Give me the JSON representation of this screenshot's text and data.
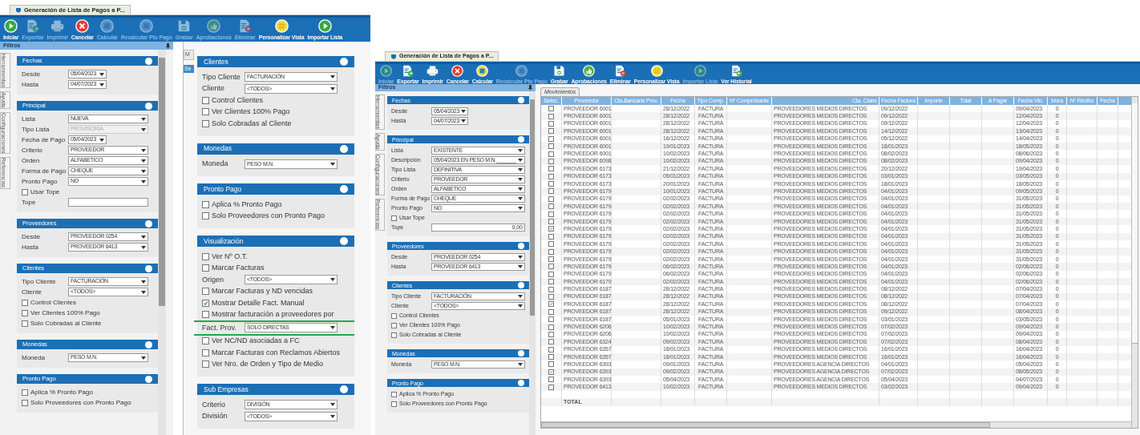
{
  "left_window": {
    "title": "Generación de Lista de Pagos a P...",
    "toolbar": [
      {
        "label": "Iniciar",
        "kind": "play",
        "disabled": false
      },
      {
        "label": "Exportar",
        "kind": "export",
        "disabled": true
      },
      {
        "label": "Imprimir",
        "kind": "print",
        "disabled": true
      },
      {
        "label": "Cancelar",
        "kind": "cancel",
        "disabled": false
      },
      {
        "label": "Calcular",
        "kind": "calc",
        "disabled": true
      },
      {
        "label": "Recalcular Pto Pago",
        "kind": "calc",
        "disabled": true
      },
      {
        "label": "Grabar",
        "kind": "save",
        "disabled": true
      },
      {
        "label": "Aprobaciones",
        "kind": "approve",
        "disabled": true
      },
      {
        "label": "Eliminar",
        "kind": "delete",
        "disabled": true
      },
      {
        "label": "Personalizar Vista",
        "kind": "grid",
        "disabled": false
      },
      {
        "label": "Importar Lista",
        "kind": "play",
        "disabled": false
      }
    ],
    "panel_title": "Filtros",
    "side_tabs": [
      "Herramientas",
      "Ayuda",
      "Configuraciones",
      "Referencias"
    ],
    "filter_sections": [
      {
        "title": "Fechas",
        "rows": [
          {
            "kind": "date",
            "label": "Desde",
            "value": "05/04/2023"
          },
          {
            "kind": "date",
            "label": "Hasta",
            "value": "04/07/2023"
          }
        ]
      },
      {
        "title": "Principal",
        "rows": [
          {
            "kind": "select",
            "label": "Lista",
            "value": "NUEVA"
          },
          {
            "kind": "select",
            "label": "Tipo Lista",
            "value": "PROVISORIA",
            "disabled": true
          },
          {
            "kind": "date",
            "label": "Fecha de Pago",
            "value": "05/04/2023"
          },
          {
            "kind": "select",
            "label": "Criterio",
            "value": "PROVEEDOR"
          },
          {
            "kind": "select",
            "label": "Orden",
            "value": "ALFABETICO"
          },
          {
            "kind": "select",
            "label": "Forma de Pago",
            "value": "CHEQUE"
          },
          {
            "kind": "select",
            "label": "Pronto Pago",
            "value": "NO"
          },
          {
            "kind": "checkbox",
            "label": "Usar Tope",
            "checked": false
          },
          {
            "kind": "input",
            "label": "Tope"
          }
        ]
      },
      {
        "title": "Proveedores",
        "rows": [
          {
            "kind": "select",
            "label": "Desde",
            "value": "PROVEEDOR 0254"
          },
          {
            "kind": "select",
            "label": "Hasta",
            "value": "PROVEEDOR 6413"
          }
        ]
      },
      {
        "title": "Clientes",
        "rows": [
          {
            "kind": "select",
            "label": "Tipo Cliente",
            "value": "FACTURACIÓN"
          },
          {
            "kind": "select",
            "label": "Cliente",
            "value": "<TODOS>"
          },
          {
            "kind": "checkbox",
            "label": "Control Clientes",
            "checked": false
          },
          {
            "kind": "checkbox",
            "label": "Ver Clientes 100% Pago",
            "checked": false
          },
          {
            "kind": "checkbox",
            "label": "Solo Cobradas al Cliente",
            "checked": false
          }
        ]
      },
      {
        "title": "Monedas",
        "rows": [
          {
            "kind": "select",
            "label": "Moneda",
            "value": "PESO M.N."
          }
        ]
      },
      {
        "title": "Pronto Pago",
        "rows": [
          {
            "kind": "checkbox",
            "label": "Aplica % Pronto Pago",
            "checked": false
          },
          {
            "kind": "checkbox",
            "label": "Solo Proveedores con Pronto Pago",
            "checked": false
          }
        ]
      }
    ],
    "background_tab": "M",
    "background_header": "Se",
    "option_sections": [
      {
        "title": "Clientes",
        "rows": [
          {
            "kind": "select",
            "label": "Tipo Cliente",
            "value": "FACTURACIÓN"
          },
          {
            "kind": "select",
            "label": "Cliente",
            "value": "<TODOS>"
          },
          {
            "kind": "checkbox",
            "label": "Control Clientes",
            "checked": false
          },
          {
            "kind": "checkbox",
            "label": "Ver Clientes 100% Pago",
            "checked": false
          },
          {
            "kind": "checkbox",
            "label": "Solo Cobradas al Cliente",
            "checked": false
          }
        ]
      },
      {
        "title": "Monedas",
        "rows": [
          {
            "kind": "select",
            "label": "Moneda",
            "value": "PESO M.N."
          }
        ]
      },
      {
        "title": "Pronto Pago",
        "rows": [
          {
            "kind": "checkbox",
            "label": "Aplica % Pronto Pago",
            "checked": false
          },
          {
            "kind": "checkbox",
            "label": "Solo Proveedores con Pronto Pago",
            "checked": false
          }
        ]
      },
      {
        "title": "Visualización",
        "rows": [
          {
            "kind": "checkbox",
            "label": "Ver Nº O.T.",
            "checked": false
          },
          {
            "kind": "checkbox",
            "label": "Marcar Facturas",
            "checked": false
          },
          {
            "kind": "select",
            "label": "Origen",
            "value": "<TODOS>"
          },
          {
            "kind": "checkbox",
            "label": "Marcar Facturas y ND vencidas",
            "checked": false
          },
          {
            "kind": "checkbox",
            "label": "Mostrar Detalle Fact. Manual",
            "checked": true
          },
          {
            "kind": "checkbox",
            "label": "Mostrar facturación a proveedores por",
            "checked": false
          },
          {
            "kind": "select",
            "label": "Fact. Prov.",
            "value": "SOLO DIRECTAS",
            "highlighted": true
          },
          {
            "kind": "checkbox",
            "label": "Ver NC/ND asociadas a FC",
            "checked": false
          },
          {
            "kind": "checkbox",
            "label": "Marcar Facturas con Reclamos Abiertos",
            "checked": false
          },
          {
            "kind": "checkbox",
            "label": "Ver Nro. de Orden y Tipo de Medio",
            "checked": false
          }
        ]
      },
      {
        "title": "Sub Empresas",
        "rows": [
          {
            "kind": "select",
            "label": "Criterio",
            "value": "DIVISIÓN"
          },
          {
            "kind": "select",
            "label": "División",
            "value": "<TODOS>"
          }
        ]
      }
    ]
  },
  "right_window": {
    "title": "Generación de Lista de Pagos a P...",
    "toolbar": [
      {
        "label": "Iniciar",
        "kind": "play",
        "disabled": true
      },
      {
        "label": "Exportar",
        "kind": "export",
        "disabled": false
      },
      {
        "label": "Imprimir",
        "kind": "print",
        "disabled": false
      },
      {
        "label": "Cancelar",
        "kind": "cancel",
        "disabled": false
      },
      {
        "label": "Calcular",
        "kind": "calc",
        "disabled": false
      },
      {
        "label": "Recalcular Pto Pago",
        "kind": "calc",
        "disabled": true
      },
      {
        "label": "Grabar",
        "kind": "save",
        "disabled": false
      },
      {
        "label": "Aprobaciones",
        "kind": "approve",
        "disabled": false
      },
      {
        "label": "Eliminar",
        "kind": "delete",
        "disabled": false
      },
      {
        "label": "Personalizar Vista",
        "kind": "grid",
        "disabled": false
      },
      {
        "label": "Importar Lista",
        "kind": "play",
        "disabled": true
      },
      {
        "label": "Ver Historial",
        "kind": "history",
        "disabled": false
      }
    ],
    "panel_title": "Filtros",
    "side_tabs": [
      "Herramientas",
      "Ayuda",
      "Configuraciones",
      "Referencias"
    ],
    "filter_sections": [
      {
        "title": "Fechas",
        "rows": [
          {
            "kind": "date",
            "label": "Desde",
            "value": "05/04/2023"
          },
          {
            "kind": "date",
            "label": "Hasta",
            "value": "04/07/2023"
          }
        ]
      },
      {
        "title": "Principal",
        "rows": [
          {
            "kind": "select",
            "label": "Lista",
            "value": "EXISTENTE"
          },
          {
            "kind": "select",
            "label": "Descripción",
            "value": "05/04/2023 EN PESO M.N._______"
          },
          {
            "kind": "select",
            "label": "Tipo Lista",
            "value": "DEFINITIVA"
          },
          {
            "kind": "select",
            "label": "Criterio",
            "value": "PROVEEDOR"
          },
          {
            "kind": "select",
            "label": "Orden",
            "value": "ALFABETICO"
          },
          {
            "kind": "select",
            "label": "Forma de Pago",
            "value": "CHEQUE"
          },
          {
            "kind": "select",
            "label": "Pronto Pago",
            "value": "NO"
          },
          {
            "kind": "checkbox",
            "label": "Usar Tope",
            "checked": false
          },
          {
            "kind": "input",
            "label": "Tope",
            "value": "0,00"
          }
        ]
      },
      {
        "title": "Proveedores",
        "rows": [
          {
            "kind": "select",
            "label": "Desde",
            "value": "PROVEEDOR 0254"
          },
          {
            "kind": "select",
            "label": "Hasta",
            "value": "PROVEEDOR 6413"
          }
        ]
      },
      {
        "title": "Clientes",
        "rows": [
          {
            "kind": "select",
            "label": "Tipo Cliente",
            "value": "FACTURACIÓN"
          },
          {
            "kind": "select",
            "label": "Cliente",
            "value": "<TODOS>"
          },
          {
            "kind": "checkbox",
            "label": "Control Clientes",
            "checked": false
          },
          {
            "kind": "checkbox",
            "label": "Ver Clientes 100% Pago",
            "checked": false
          },
          {
            "kind": "checkbox",
            "label": "Solo Cobradas al Cliente",
            "checked": false
          }
        ]
      },
      {
        "title": "Monedas",
        "rows": [
          {
            "kind": "select",
            "label": "Moneda",
            "value": "PESO M.N."
          }
        ]
      },
      {
        "title": "Pronto Pago",
        "rows": [
          {
            "kind": "checkbox",
            "label": "Aplica % Pronto Pago",
            "checked": false
          },
          {
            "kind": "checkbox",
            "label": "Solo Proveedores con Pronto Pago",
            "checked": false
          }
        ]
      }
    ],
    "table": {
      "tab": "Movimientos",
      "columns": [
        "Selec.",
        "Proveedor",
        "Cta.Bancaria Prov.",
        "Fecha",
        "Tipo Comp.",
        "Nº Comprobante",
        "Cta. Clabe",
        "Fecha Factura",
        "Importe",
        "Total",
        "A Pagar",
        "Fecha Vto.",
        "Mora",
        "Nº Recibo",
        "Fecha"
      ],
      "rows": [
        {
          "checked": false,
          "proveedor": "PROVEEDOR 6001",
          "fecha": "28/12/2022",
          "tipo": "FACTURA",
          "cta_clabe": "PROVEEDORES MEDIOS DIRECTOS",
          "fecha_factura": "09/12/2022",
          "fecha_vto": "09/04/2023",
          "mora": "0"
        },
        {
          "checked": false,
          "proveedor": "PROVEEDOR 6001",
          "fecha": "28/12/2022",
          "tipo": "FACTURA",
          "cta_clabe": "PROVEEDORES MEDIOS DIRECTOS",
          "fecha_factura": "09/12/2022",
          "fecha_vto": "12/04/2023",
          "mora": "0"
        },
        {
          "checked": false,
          "proveedor": "PROVEEDOR 6001",
          "fecha": "28/12/2022",
          "tipo": "FACTURA",
          "cta_clabe": "PROVEEDORES MEDIOS DIRECTOS",
          "fecha_factura": "09/12/2022",
          "fecha_vto": "12/04/2023",
          "mora": "0"
        },
        {
          "checked": false,
          "proveedor": "PROVEEDOR 6001",
          "fecha": "28/12/2022",
          "tipo": "FACTURA",
          "cta_clabe": "PROVEEDORES MEDIOS DIRECTOS",
          "fecha_factura": "14/12/2022",
          "fecha_vto": "13/04/2023",
          "mora": "0"
        },
        {
          "checked": false,
          "proveedor": "PROVEEDOR 6001",
          "fecha": "16/12/2022",
          "tipo": "FACTURA",
          "cta_clabe": "PROVEEDORES MEDIOS DIRECTOS",
          "fecha_factura": "05/12/2022",
          "fecha_vto": "14/04/2023",
          "mora": "0"
        },
        {
          "checked": false,
          "proveedor": "PROVEEDOR 6001",
          "fecha": "19/01/2023",
          "tipo": "FACTURA",
          "cta_clabe": "PROVEEDORES MEDIOS DIRECTOS",
          "fecha_factura": "18/01/2023",
          "fecha_vto": "18/05/2023",
          "mora": "0"
        },
        {
          "checked": false,
          "proveedor": "PROVEEDOR 6001",
          "fecha": "10/02/2023",
          "tipo": "FACTURA",
          "cta_clabe": "PROVEEDORES MEDIOS DIRECTOS",
          "fecha_factura": "08/02/2023",
          "fecha_vto": "08/06/2023",
          "mora": "0"
        },
        {
          "checked": false,
          "proveedor": "PROVEEDOR 6098",
          "fecha": "10/02/2023",
          "tipo": "FACTURA",
          "cta_clabe": "PROVEEDORES MEDIOS DIRECTOS",
          "fecha_factura": "08/02/2023",
          "fecha_vto": "09/04/2023",
          "mora": "0"
        },
        {
          "checked": false,
          "proveedor": "PROVEEDOR 6173",
          "fecha": "21/12/2022",
          "tipo": "FACTURA",
          "cta_clabe": "PROVEEDORES MEDIOS DIRECTOS",
          "fecha_factura": "20/12/2022",
          "fecha_vto": "19/04/2023",
          "mora": "0"
        },
        {
          "checked": false,
          "proveedor": "PROVEEDOR 6173",
          "fecha": "05/01/2023",
          "tipo": "FACTURA",
          "cta_clabe": "PROVEEDORES MEDIOS DIRECTOS",
          "fecha_factura": "03/01/2023",
          "fecha_vto": "03/05/2023",
          "mora": "0"
        },
        {
          "checked": false,
          "proveedor": "PROVEEDOR 6173",
          "fecha": "20/01/2023",
          "tipo": "FACTURA",
          "cta_clabe": "PROVEEDORES MEDIOS DIRECTOS",
          "fecha_factura": "18/01/2023",
          "fecha_vto": "18/05/2023",
          "mora": "0"
        },
        {
          "checked": false,
          "proveedor": "PROVEEDOR 6179",
          "fecha": "10/01/2023",
          "tipo": "FACTURA",
          "cta_clabe": "PROVEEDORES MEDIOS DIRECTOS",
          "fecha_factura": "04/01/2023",
          "fecha_vto": "09/05/2023",
          "mora": "0"
        },
        {
          "checked": false,
          "proveedor": "PROVEEDOR 6179",
          "fecha": "02/02/2023",
          "tipo": "FACTURA",
          "cta_clabe": "PROVEEDORES MEDIOS DIRECTOS",
          "fecha_factura": "04/01/2023",
          "fecha_vto": "31/05/2023",
          "mora": "0"
        },
        {
          "checked": false,
          "proveedor": "PROVEEDOR 6179",
          "fecha": "02/02/2023",
          "tipo": "FACTURA",
          "cta_clabe": "PROVEEDORES MEDIOS DIRECTOS",
          "fecha_factura": "04/01/2023",
          "fecha_vto": "31/05/2023",
          "mora": "0"
        },
        {
          "checked": false,
          "proveedor": "PROVEEDOR 6179",
          "fecha": "02/02/2023",
          "tipo": "FACTURA",
          "cta_clabe": "PROVEEDORES MEDIOS DIRECTOS",
          "fecha_factura": "04/01/2023",
          "fecha_vto": "31/05/2023",
          "mora": "0"
        },
        {
          "checked": false,
          "proveedor": "PROVEEDOR 6179",
          "fecha": "02/02/2023",
          "tipo": "FACTURA",
          "cta_clabe": "PROVEEDORES MEDIOS DIRECTOS",
          "fecha_factura": "04/01/2023",
          "fecha_vto": "31/05/2023",
          "mora": "0"
        },
        {
          "checked": true,
          "proveedor": "PROVEEDOR 6179",
          "fecha": "02/02/2023",
          "tipo": "FACTURA",
          "cta_clabe": "PROVEEDORES MEDIOS DIRECTOS",
          "fecha_factura": "04/01/2023",
          "fecha_vto": "31/05/2023",
          "mora": "0"
        },
        {
          "checked": false,
          "proveedor": "PROVEEDOR 6179",
          "fecha": "02/02/2023",
          "tipo": "FACTURA",
          "cta_clabe": "PROVEEDORES MEDIOS DIRECTOS",
          "fecha_factura": "04/01/2023",
          "fecha_vto": "31/05/2023",
          "mora": "0"
        },
        {
          "checked": false,
          "proveedor": "PROVEEDOR 6179",
          "fecha": "02/02/2023",
          "tipo": "FACTURA",
          "cta_clabe": "PROVEEDORES MEDIOS DIRECTOS",
          "fecha_factura": "04/01/2023",
          "fecha_vto": "31/05/2023",
          "mora": "0"
        },
        {
          "checked": false,
          "proveedor": "PROVEEDOR 6179",
          "fecha": "02/02/2023",
          "tipo": "FACTURA",
          "cta_clabe": "PROVEEDORES MEDIOS DIRECTOS",
          "fecha_factura": "04/01/2023",
          "fecha_vto": "31/05/2023",
          "mora": "0"
        },
        {
          "checked": false,
          "proveedor": "PROVEEDOR 6179",
          "fecha": "02/02/2023",
          "tipo": "FACTURA",
          "cta_clabe": "PROVEEDORES MEDIOS DIRECTOS",
          "fecha_factura": "04/01/2023",
          "fecha_vto": "31/05/2023",
          "mora": "0"
        },
        {
          "checked": false,
          "proveedor": "PROVEEDOR 6179",
          "fecha": "06/02/2023",
          "tipo": "FACTURA",
          "cta_clabe": "PROVEEDORES MEDIOS DIRECTOS",
          "fecha_factura": "04/01/2023",
          "fecha_vto": "02/06/2023",
          "mora": "0"
        },
        {
          "checked": false,
          "proveedor": "PROVEEDOR 6179",
          "fecha": "06/02/2023",
          "tipo": "FACTURA",
          "cta_clabe": "PROVEEDORES MEDIOS DIRECTOS",
          "fecha_factura": "04/01/2023",
          "fecha_vto": "02/06/2023",
          "mora": "0"
        },
        {
          "checked": false,
          "proveedor": "PROVEEDOR 6179",
          "fecha": "02/02/2023",
          "tipo": "FACTURA",
          "cta_clabe": "PROVEEDORES MEDIOS DIRECTOS",
          "fecha_factura": "04/01/2023",
          "fecha_vto": "02/06/2023",
          "mora": "0"
        },
        {
          "checked": false,
          "proveedor": "PROVEEDOR 6187",
          "fecha": "28/12/2022",
          "tipo": "FACTURA",
          "cta_clabe": "PROVEEDORES MEDIOS DIRECTOS",
          "fecha_factura": "08/12/2022",
          "fecha_vto": "07/04/2023",
          "mora": "0"
        },
        {
          "checked": false,
          "proveedor": "PROVEEDOR 6187",
          "fecha": "28/12/2022",
          "tipo": "FACTURA",
          "cta_clabe": "PROVEEDORES MEDIOS DIRECTOS",
          "fecha_factura": "08/12/2022",
          "fecha_vto": "07/04/2023",
          "mora": "0"
        },
        {
          "checked": true,
          "proveedor": "PROVEEDOR 6187",
          "fecha": "28/12/2022",
          "tipo": "FACTURA",
          "cta_clabe": "PROVEEDORES MEDIOS DIRECTOS",
          "fecha_factura": "08/12/2022",
          "fecha_vto": "07/04/2023",
          "mora": "0"
        },
        {
          "checked": false,
          "proveedor": "PROVEEDOR 6187",
          "fecha": "28/12/2022",
          "tipo": "FACTURA",
          "cta_clabe": "PROVEEDORES MEDIOS DIRECTOS",
          "fecha_factura": "09/12/2022",
          "fecha_vto": "08/04/2023",
          "mora": "0"
        },
        {
          "checked": false,
          "proveedor": "PROVEEDOR 6187",
          "fecha": "05/01/2023",
          "tipo": "FACTURA",
          "cta_clabe": "PROVEEDORES MEDIOS DIRECTOS",
          "fecha_factura": "03/01/2023",
          "fecha_vto": "03/05/2023",
          "mora": "0"
        },
        {
          "checked": false,
          "proveedor": "PROVEEDOR 6206",
          "fecha": "10/02/2023",
          "tipo": "FACTURA",
          "cta_clabe": "PROVEEDORES MEDIOS DIRECTOS",
          "fecha_factura": "07/02/2023",
          "fecha_vto": "09/04/2023",
          "mora": "0"
        },
        {
          "checked": false,
          "proveedor": "PROVEEDOR 6206",
          "fecha": "10/02/2023",
          "tipo": "FACTURA",
          "cta_clabe": "PROVEEDORES MEDIOS DIRECTOS",
          "fecha_factura": "07/02/2023",
          "fecha_vto": "09/04/2023",
          "mora": "0"
        },
        {
          "checked": false,
          "proveedor": "PROVEEDOR 6324",
          "fecha": "09/02/2023",
          "tipo": "FACTURA",
          "cta_clabe": "PROVEEDORES MEDIOS DIRECTOS",
          "fecha_factura": "07/02/2023",
          "fecha_vto": "08/04/2023",
          "mora": "0"
        },
        {
          "checked": false,
          "proveedor": "PROVEEDOR 6357",
          "fecha": "18/01/2023",
          "tipo": "FACTURA",
          "cta_clabe": "PROVEEDORES MEDIOS DIRECTOS",
          "fecha_factura": "16/01/2023",
          "fecha_vto": "16/04/2023",
          "mora": "0"
        },
        {
          "checked": false,
          "proveedor": "PROVEEDOR 6357",
          "fecha": "18/01/2023",
          "tipo": "FACTURA",
          "cta_clabe": "PROVEEDORES MEDIOS DIRECTOS",
          "fecha_factura": "16/01/2023",
          "fecha_vto": "16/04/2023",
          "mora": "0"
        },
        {
          "checked": false,
          "proveedor": "PROVEEDOR 6393",
          "fecha": "09/01/2023",
          "tipo": "FACTURA",
          "cta_clabe": "PROVEEDORES AGENCIA DIRECTOS",
          "fecha_factura": "04/01/2023",
          "fecha_vto": "05/04/2023",
          "mora": "0"
        },
        {
          "checked": true,
          "proveedor": "PROVEEDOR 6393",
          "fecha": "09/02/2023",
          "tipo": "FACTURA",
          "cta_clabe": "PROVEEDORES AGENCIA DIRECTOS",
          "fecha_factura": "07/02/2023",
          "fecha_vto": "08/05/2023",
          "mora": "0"
        },
        {
          "checked": false,
          "proveedor": "PROVEEDOR 6393",
          "fecha": "05/04/2023",
          "tipo": "FACTURA",
          "cta_clabe": "PROVEEDORES AGENCIA DIRECTOS",
          "fecha_factura": "05/04/2023",
          "fecha_vto": "04/07/2023",
          "mora": "0"
        },
        {
          "checked": false,
          "proveedor": "PROVEEDOR 6413",
          "fecha": "10/02/2023",
          "tipo": "FACTURA",
          "cta_clabe": "PROVEEDORES MEDIOS DIRECTOS",
          "fecha_factura": "03/02/2023",
          "fecha_vto": "09/04/2023",
          "mora": "0"
        }
      ],
      "total_label": "TOTAL"
    }
  }
}
